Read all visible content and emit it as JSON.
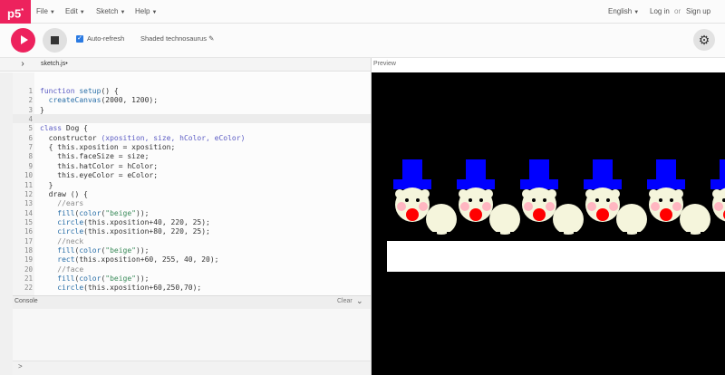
{
  "nav": {
    "logo": "p5",
    "menus": [
      {
        "label": "File"
      },
      {
        "label": "Edit"
      },
      {
        "label": "Sketch"
      },
      {
        "label": "Help"
      }
    ],
    "language": "English",
    "login": "Log in",
    "or": "or",
    "signup": "Sign up"
  },
  "toolbar": {
    "auto_refresh_label": "Auto-refresh",
    "auto_refresh_checked": true,
    "project_name": "Shaded technosaurus",
    "accent": "#ed225d"
  },
  "editor": {
    "file_name": "sketch.js",
    "unsaved_marker": "•",
    "preview_label": "Preview",
    "lines": [
      [
        {
          "t": "function ",
          "c": "kw"
        },
        {
          "t": "setup",
          "c": "fn"
        },
        {
          "t": "() {",
          "c": "tx"
        }
      ],
      [
        {
          "t": "  createCanvas",
          "c": "fn"
        },
        {
          "t": "(2000, 1200);",
          "c": "tx"
        }
      ],
      [
        {
          "t": "}",
          "c": "tx"
        }
      ],
      [
        {
          "t": "",
          "c": "tx"
        }
      ],
      [
        {
          "t": "class ",
          "c": "kw"
        },
        {
          "t": "Dog {",
          "c": "tx"
        }
      ],
      [
        {
          "t": "  constructor ",
          "c": "tx"
        },
        {
          "t": "(xposition, size, hColor, eColor)",
          "c": "kw"
        }
      ],
      [
        {
          "t": "  { this.xposition = xposition;",
          "c": "tx"
        }
      ],
      [
        {
          "t": "    this.faceSize = size;",
          "c": "tx"
        }
      ],
      [
        {
          "t": "    this.hatColor = hColor;",
          "c": "tx"
        }
      ],
      [
        {
          "t": "    this.eyeColor = eColor;",
          "c": "tx"
        }
      ],
      [
        {
          "t": "  }",
          "c": "tx"
        }
      ],
      [
        {
          "t": "  draw () {",
          "c": "tx"
        }
      ],
      [
        {
          "t": "    //ears",
          "c": "cm"
        }
      ],
      [
        {
          "t": "    fill",
          "c": "fn"
        },
        {
          "t": "(",
          "c": "tx"
        },
        {
          "t": "color",
          "c": "fn"
        },
        {
          "t": "(",
          "c": "tx"
        },
        {
          "t": "\"beige\"",
          "c": "str"
        },
        {
          "t": "));",
          "c": "tx"
        }
      ],
      [
        {
          "t": "    circle",
          "c": "fn"
        },
        {
          "t": "(this.xposition+40, 220, 25);",
          "c": "tx"
        }
      ],
      [
        {
          "t": "    circle",
          "c": "fn"
        },
        {
          "t": "(this.xposition+80, 220, 25);",
          "c": "tx"
        }
      ],
      [
        {
          "t": "    //neck",
          "c": "cm"
        }
      ],
      [
        {
          "t": "    fill",
          "c": "fn"
        },
        {
          "t": "(",
          "c": "tx"
        },
        {
          "t": "color",
          "c": "fn"
        },
        {
          "t": "(",
          "c": "tx"
        },
        {
          "t": "\"beige\"",
          "c": "str"
        },
        {
          "t": "));",
          "c": "tx"
        }
      ],
      [
        {
          "t": "    rect",
          "c": "fn"
        },
        {
          "t": "(this.xposition+60, 255, 40, 20);",
          "c": "tx"
        }
      ],
      [
        {
          "t": "    //face",
          "c": "cm"
        }
      ],
      [
        {
          "t": "    fill",
          "c": "fn"
        },
        {
          "t": "(",
          "c": "tx"
        },
        {
          "t": "color",
          "c": "fn"
        },
        {
          "t": "(",
          "c": "tx"
        },
        {
          "t": "\"beige\"",
          "c": "str"
        },
        {
          "t": "));",
          "c": "tx"
        }
      ],
      [
        {
          "t": "    circle",
          "c": "fn"
        },
        {
          "t": "(this.xposition+60,250,70);",
          "c": "tx"
        }
      ]
    ]
  },
  "console": {
    "label": "Console",
    "clear_label": "Clear",
    "prompt": ">"
  },
  "preview": {
    "background": "#000000",
    "hat_color": "#0000ff",
    "face_color": "#f5f5dc",
    "nose_color": "#ff0000",
    "cheek_color": "#ffb6c1",
    "dogs": [
      1,
      2,
      3,
      4,
      5,
      6
    ]
  }
}
